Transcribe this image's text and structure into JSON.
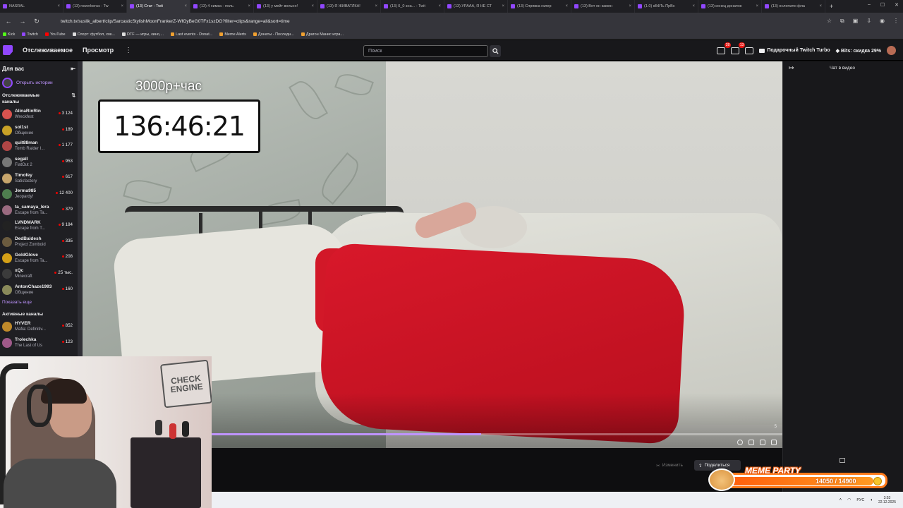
{
  "browser": {
    "tabs": [
      {
        "label": "NASRAL",
        "active": false
      },
      {
        "label": "(13) nezerberus - Tw",
        "active": false
      },
      {
        "label": "(13) Стат - Twit",
        "active": true
      },
      {
        "label": "(13) 4 химка - поль",
        "active": false
      },
      {
        "label": "(13) у мейт вольно!",
        "active": false
      },
      {
        "label": "(13) Я ЖИВАТЛКА!",
        "active": false
      },
      {
        "label": "(13) 0_0 зна... - Twit",
        "active": false
      },
      {
        "label": "(13) УРААА, Я НЕ СТ",
        "active": false
      },
      {
        "label": "(13) Спрявка галер",
        "active": false
      },
      {
        "label": "(13) Вот он камен",
        "active": false
      },
      {
        "label": "(1.0) кБФТь ПрВс",
        "active": false
      },
      {
        "label": "(13) конец донатов",
        "active": false
      },
      {
        "label": "(13) ослепило фла",
        "active": false
      }
    ],
    "url": "twitch.tv/suslik_albert/clip/SarcasticStylishMoonFrankerZ-WfOyBeG0TFx1szDG?filter=clips&range=all&sort=time",
    "bookmarks": [
      {
        "label": "Kick",
        "color": "#53fc18"
      },
      {
        "label": "Twitch",
        "color": "#9147ff"
      },
      {
        "label": "YouTube",
        "color": "#ff0000"
      },
      {
        "label": "Спорт: футбол, хок...",
        "color": "#dddddd"
      },
      {
        "label": "DTF — игры, кино,...",
        "color": "#dddddd"
      },
      {
        "label": "Last events - Donat...",
        "color": "#f0a030"
      },
      {
        "label": "Meme Alerts",
        "color": "#f0a030"
      },
      {
        "label": "Донаты - Последн...",
        "color": "#f0a030"
      },
      {
        "label": "Драгон Манис игра...",
        "color": "#f0a030"
      }
    ]
  },
  "twitch": {
    "nav": {
      "following": "Отслеживаемое",
      "browse": "Просмотр"
    },
    "search_placeholder": "Поиск",
    "notif_count_1": "28",
    "notif_count_2": "13",
    "turbo_label": "Подарочный Twitch Turbo",
    "bits_label": "Bits: скидка 29%"
  },
  "sidebar": {
    "title": "Для вас",
    "stories": "Открыть истории",
    "followed_title": "Отслеживаемые каналы",
    "channels": [
      {
        "name": "AlinaRinRin",
        "game": "Wreckfest",
        "viewers": "3 124",
        "color": "#d9534f"
      },
      {
        "name": "sol1st",
        "game": "Общение",
        "viewers": "189",
        "color": "#c9a227"
      },
      {
        "name": "quit88man",
        "game": "Tomb Raider I...",
        "viewers": "1 177",
        "color": "#b04646"
      },
      {
        "name": "segall",
        "game": "FlatOut 2",
        "viewers": "953",
        "color": "#777777"
      },
      {
        "name": "Timofey",
        "game": "Satisfactory",
        "viewers": "617",
        "color": "#c7a56c"
      },
      {
        "name": "Jerma985",
        "game": "Jeopardy!",
        "viewers": "12 400",
        "color": "#4e7d4f"
      },
      {
        "name": "ta_samaya_lera",
        "game": "Escape from Ta...",
        "viewers": "379",
        "color": "#9a6a80"
      },
      {
        "name": "LVNDMARK",
        "game": "Escape from T...",
        "viewers": "9 184",
        "color": "#222222"
      },
      {
        "name": "DedBaldesh",
        "game": "Project Zomboid",
        "viewers": "335",
        "color": "#6b5b3f"
      },
      {
        "name": "GoldGlove",
        "game": "Escape from Ta...",
        "viewers": "208",
        "color": "#d4a017"
      },
      {
        "name": "xQc",
        "game": "Minecraft",
        "viewers": "25 тыс.",
        "color": "#3b3b3b"
      },
      {
        "name": "AntonChaze1993",
        "game": "Общение",
        "viewers": "160",
        "color": "#8a8a5a"
      }
    ],
    "show_more": "Показать еще",
    "active_title": "Активные каналы",
    "active_channels": [
      {
        "name": "HYVER",
        "game": "Mafia: Definitiv...",
        "viewers": "852",
        "color": "#c08a2a"
      },
      {
        "name": "Trolechka",
        "game": "The Last of Us",
        "viewers": "123",
        "color": "#a05a8a"
      }
    ]
  },
  "video": {
    "overlay_rate": "3000р+час",
    "overlay_timer": "136:46:21",
    "progress": 0.57,
    "corner_number": "5"
  },
  "actions": {
    "edit": "Изменить",
    "share": "Поделиться"
  },
  "chat": {
    "title": "Чат в видео"
  },
  "meme_widget": {
    "title": "MEME PARTY",
    "current": 14050,
    "goal": 14900,
    "count_text": "14050 / 14900"
  },
  "taskbar": {
    "lang": "РУС",
    "time": "3:53",
    "date": "22.12.2025"
  }
}
